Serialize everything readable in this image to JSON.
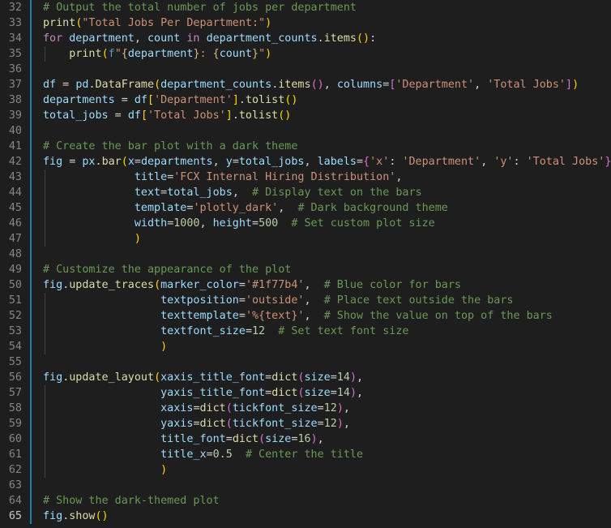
{
  "editor": {
    "language": "python",
    "first_line_number": 32,
    "active_line_number": 65,
    "theme_colors": {
      "background": "#1e1e1e",
      "line_number": "#858585",
      "active_line_number": "#c6c6c6",
      "comment": "#6a9955",
      "function": "#dcdcaa",
      "string": "#ce9178",
      "keyword": "#c586c0",
      "variable": "#9cdcfe",
      "plain": "#d4d4d4",
      "bracket_level_1": "#ffd700",
      "bracket_level_2": "#da70d6",
      "bracket_level_3": "#179fff",
      "number": "#b5cea8",
      "modified_gutter": "#1b81a8"
    },
    "lines": [
      {
        "n": "32",
        "tokens": [
          [
            "# Output the total number of jobs per department",
            "cm"
          ]
        ]
      },
      {
        "n": "33",
        "tokens": [
          [
            "print",
            "fn"
          ],
          [
            "(",
            "b1"
          ],
          [
            "\"Total Jobs Per Department:\"",
            "st"
          ],
          [
            ")",
            "b1"
          ]
        ]
      },
      {
        "n": "34",
        "tokens": [
          [
            "for",
            "kw"
          ],
          [
            " ",
            "pl"
          ],
          [
            "department",
            "vr"
          ],
          [
            ", ",
            "pl"
          ],
          [
            "count",
            "vr"
          ],
          [
            " ",
            "pl"
          ],
          [
            "in",
            "kw"
          ],
          [
            " ",
            "pl"
          ],
          [
            "department_counts",
            "vr"
          ],
          [
            ".",
            "pl"
          ],
          [
            "items",
            "fn"
          ],
          [
            "()",
            "b1"
          ],
          [
            ":",
            "pl"
          ]
        ]
      },
      {
        "n": "35",
        "tokens": [
          [
            "    ",
            "pl"
          ],
          [
            "print",
            "fn"
          ],
          [
            "(",
            "b1"
          ],
          [
            "f",
            "ex"
          ],
          [
            "\"",
            "st"
          ],
          [
            "{",
            "sp"
          ],
          [
            "department",
            "vr"
          ],
          [
            "}",
            "sp"
          ],
          [
            ": ",
            "st"
          ],
          [
            "{",
            "sp"
          ],
          [
            "count",
            "vr"
          ],
          [
            "}",
            "sp"
          ],
          [
            "\"",
            "st"
          ],
          [
            ")",
            "b1"
          ]
        ]
      },
      {
        "n": "36",
        "tokens": []
      },
      {
        "n": "37",
        "tokens": [
          [
            "df",
            "vr"
          ],
          [
            " = ",
            "pl"
          ],
          [
            "pd",
            "vr"
          ],
          [
            ".",
            "pl"
          ],
          [
            "DataFrame",
            "fn"
          ],
          [
            "(",
            "b1"
          ],
          [
            "department_counts",
            "vr"
          ],
          [
            ".",
            "pl"
          ],
          [
            "items",
            "fn"
          ],
          [
            "()",
            "b2"
          ],
          [
            ", ",
            "pl"
          ],
          [
            "columns",
            "vr"
          ],
          [
            "=",
            "pl"
          ],
          [
            "[",
            "b2"
          ],
          [
            "'Department'",
            "st"
          ],
          [
            ", ",
            "pl"
          ],
          [
            "'Total Jobs'",
            "st"
          ],
          [
            "]",
            "b2"
          ],
          [
            ")",
            "b1"
          ]
        ]
      },
      {
        "n": "38",
        "tokens": [
          [
            "departments",
            "vr"
          ],
          [
            " = ",
            "pl"
          ],
          [
            "df",
            "vr"
          ],
          [
            "[",
            "b1"
          ],
          [
            "'Department'",
            "st"
          ],
          [
            "]",
            "b1"
          ],
          [
            ".",
            "pl"
          ],
          [
            "tolist",
            "fn"
          ],
          [
            "()",
            "b1"
          ]
        ]
      },
      {
        "n": "39",
        "tokens": [
          [
            "total_jobs",
            "vr"
          ],
          [
            " = ",
            "pl"
          ],
          [
            "df",
            "vr"
          ],
          [
            "[",
            "b1"
          ],
          [
            "'Total Jobs'",
            "st"
          ],
          [
            "]",
            "b1"
          ],
          [
            ".",
            "pl"
          ],
          [
            "tolist",
            "fn"
          ],
          [
            "()",
            "b1"
          ]
        ]
      },
      {
        "n": "40",
        "tokens": []
      },
      {
        "n": "41",
        "tokens": [
          [
            "# Create the bar plot with a dark theme",
            "cm"
          ]
        ]
      },
      {
        "n": "42",
        "tokens": [
          [
            "fig",
            "vr"
          ],
          [
            " = ",
            "pl"
          ],
          [
            "px",
            "vr"
          ],
          [
            ".",
            "pl"
          ],
          [
            "bar",
            "fn"
          ],
          [
            "(",
            "b1"
          ],
          [
            "x",
            "vr"
          ],
          [
            "=",
            "pl"
          ],
          [
            "departments",
            "vr"
          ],
          [
            ", ",
            "pl"
          ],
          [
            "y",
            "vr"
          ],
          [
            "=",
            "pl"
          ],
          [
            "total_jobs",
            "vr"
          ],
          [
            ", ",
            "pl"
          ],
          [
            "labels",
            "vr"
          ],
          [
            "=",
            "pl"
          ],
          [
            "{",
            "b2"
          ],
          [
            "'x'",
            "st"
          ],
          [
            ": ",
            "pl"
          ],
          [
            "'Department'",
            "st"
          ],
          [
            ", ",
            "pl"
          ],
          [
            "'y'",
            "st"
          ],
          [
            ": ",
            "pl"
          ],
          [
            "'Total Jobs'",
            "st"
          ],
          [
            "}",
            "b2"
          ],
          [
            ",",
            "pl"
          ]
        ]
      },
      {
        "n": "43",
        "tokens": [
          [
            "              ",
            "pl"
          ],
          [
            "title",
            "vr"
          ],
          [
            "=",
            "pl"
          ],
          [
            "'FCX Internal Hiring Distribution'",
            "st"
          ],
          [
            ",",
            "pl"
          ]
        ]
      },
      {
        "n": "44",
        "tokens": [
          [
            "              ",
            "pl"
          ],
          [
            "text",
            "vr"
          ],
          [
            "=",
            "pl"
          ],
          [
            "total_jobs",
            "vr"
          ],
          [
            ",  ",
            "pl"
          ],
          [
            "# Display text on the bars",
            "cm"
          ]
        ]
      },
      {
        "n": "45",
        "tokens": [
          [
            "              ",
            "pl"
          ],
          [
            "template",
            "vr"
          ],
          [
            "=",
            "pl"
          ],
          [
            "'plotly_dark'",
            "st"
          ],
          [
            ",  ",
            "pl"
          ],
          [
            "# Dark background theme",
            "cm"
          ]
        ]
      },
      {
        "n": "46",
        "tokens": [
          [
            "              ",
            "pl"
          ],
          [
            "width",
            "vr"
          ],
          [
            "=",
            "pl"
          ],
          [
            "1000",
            "nm"
          ],
          [
            ", ",
            "pl"
          ],
          [
            "height",
            "vr"
          ],
          [
            "=",
            "pl"
          ],
          [
            "500",
            "nm"
          ],
          [
            "  ",
            "pl"
          ],
          [
            "# Set custom plot size",
            "cm"
          ]
        ]
      },
      {
        "n": "47",
        "tokens": [
          [
            "              ",
            "pl"
          ],
          [
            ")",
            "b1"
          ]
        ]
      },
      {
        "n": "48",
        "tokens": []
      },
      {
        "n": "49",
        "tokens": [
          [
            "# Customize the appearance of the plot",
            "cm"
          ]
        ]
      },
      {
        "n": "50",
        "tokens": [
          [
            "fig",
            "vr"
          ],
          [
            ".",
            "pl"
          ],
          [
            "update_traces",
            "fn"
          ],
          [
            "(",
            "b1"
          ],
          [
            "marker_color",
            "vr"
          ],
          [
            "=",
            "pl"
          ],
          [
            "'#1f77b4'",
            "st"
          ],
          [
            ",  ",
            "pl"
          ],
          [
            "# Blue color for bars",
            "cm"
          ]
        ]
      },
      {
        "n": "51",
        "tokens": [
          [
            "                  ",
            "pl"
          ],
          [
            "textposition",
            "vr"
          ],
          [
            "=",
            "pl"
          ],
          [
            "'outside'",
            "st"
          ],
          [
            ",  ",
            "pl"
          ],
          [
            "# Place text outside the bars",
            "cm"
          ]
        ]
      },
      {
        "n": "52",
        "tokens": [
          [
            "                  ",
            "pl"
          ],
          [
            "texttemplate",
            "vr"
          ],
          [
            "=",
            "pl"
          ],
          [
            "'%{text}'",
            "st"
          ],
          [
            ",  ",
            "pl"
          ],
          [
            "# Show the value on top of the bars",
            "cm"
          ]
        ]
      },
      {
        "n": "53",
        "tokens": [
          [
            "                  ",
            "pl"
          ],
          [
            "textfont_size",
            "vr"
          ],
          [
            "=",
            "pl"
          ],
          [
            "12",
            "nm"
          ],
          [
            "  ",
            "pl"
          ],
          [
            "# Set text font size",
            "cm"
          ]
        ]
      },
      {
        "n": "54",
        "tokens": [
          [
            "                  ",
            "pl"
          ],
          [
            ")",
            "b1"
          ]
        ]
      },
      {
        "n": "55",
        "tokens": []
      },
      {
        "n": "56",
        "tokens": [
          [
            "fig",
            "vr"
          ],
          [
            ".",
            "pl"
          ],
          [
            "update_layout",
            "fn"
          ],
          [
            "(",
            "b1"
          ],
          [
            "xaxis_title_font",
            "vr"
          ],
          [
            "=",
            "pl"
          ],
          [
            "dict",
            "fn"
          ],
          [
            "(",
            "b2"
          ],
          [
            "size",
            "vr"
          ],
          [
            "=",
            "pl"
          ],
          [
            "14",
            "nm"
          ],
          [
            ")",
            "b2"
          ],
          [
            ",",
            "pl"
          ]
        ]
      },
      {
        "n": "57",
        "tokens": [
          [
            "                  ",
            "pl"
          ],
          [
            "yaxis_title_font",
            "vr"
          ],
          [
            "=",
            "pl"
          ],
          [
            "dict",
            "fn"
          ],
          [
            "(",
            "b2"
          ],
          [
            "size",
            "vr"
          ],
          [
            "=",
            "pl"
          ],
          [
            "14",
            "nm"
          ],
          [
            ")",
            "b2"
          ],
          [
            ",",
            "pl"
          ]
        ]
      },
      {
        "n": "58",
        "tokens": [
          [
            "                  ",
            "pl"
          ],
          [
            "xaxis",
            "vr"
          ],
          [
            "=",
            "pl"
          ],
          [
            "dict",
            "fn"
          ],
          [
            "(",
            "b2"
          ],
          [
            "tickfont_size",
            "vr"
          ],
          [
            "=",
            "pl"
          ],
          [
            "12",
            "nm"
          ],
          [
            ")",
            "b2"
          ],
          [
            ",",
            "pl"
          ]
        ]
      },
      {
        "n": "59",
        "tokens": [
          [
            "                  ",
            "pl"
          ],
          [
            "yaxis",
            "vr"
          ],
          [
            "=",
            "pl"
          ],
          [
            "dict",
            "fn"
          ],
          [
            "(",
            "b2"
          ],
          [
            "tickfont_size",
            "vr"
          ],
          [
            "=",
            "pl"
          ],
          [
            "12",
            "nm"
          ],
          [
            ")",
            "b2"
          ],
          [
            ",",
            "pl"
          ]
        ]
      },
      {
        "n": "60",
        "tokens": [
          [
            "                  ",
            "pl"
          ],
          [
            "title_font",
            "vr"
          ],
          [
            "=",
            "pl"
          ],
          [
            "dict",
            "fn"
          ],
          [
            "(",
            "b2"
          ],
          [
            "size",
            "vr"
          ],
          [
            "=",
            "pl"
          ],
          [
            "16",
            "nm"
          ],
          [
            ")",
            "b2"
          ],
          [
            ",",
            "pl"
          ]
        ]
      },
      {
        "n": "61",
        "tokens": [
          [
            "                  ",
            "pl"
          ],
          [
            "title_x",
            "vr"
          ],
          [
            "=",
            "pl"
          ],
          [
            "0.5",
            "nm"
          ],
          [
            "  ",
            "pl"
          ],
          [
            "# Center the title",
            "cm"
          ]
        ]
      },
      {
        "n": "62",
        "tokens": [
          [
            "                  ",
            "pl"
          ],
          [
            ")",
            "b1"
          ]
        ]
      },
      {
        "n": "63",
        "tokens": []
      },
      {
        "n": "64",
        "tokens": [
          [
            "# Show the dark-themed plot",
            "cm"
          ]
        ]
      },
      {
        "n": "65",
        "tokens": [
          [
            "fig",
            "vr"
          ],
          [
            ".",
            "pl"
          ],
          [
            "show",
            "fn"
          ],
          [
            "()",
            "b1"
          ]
        ]
      }
    ]
  }
}
